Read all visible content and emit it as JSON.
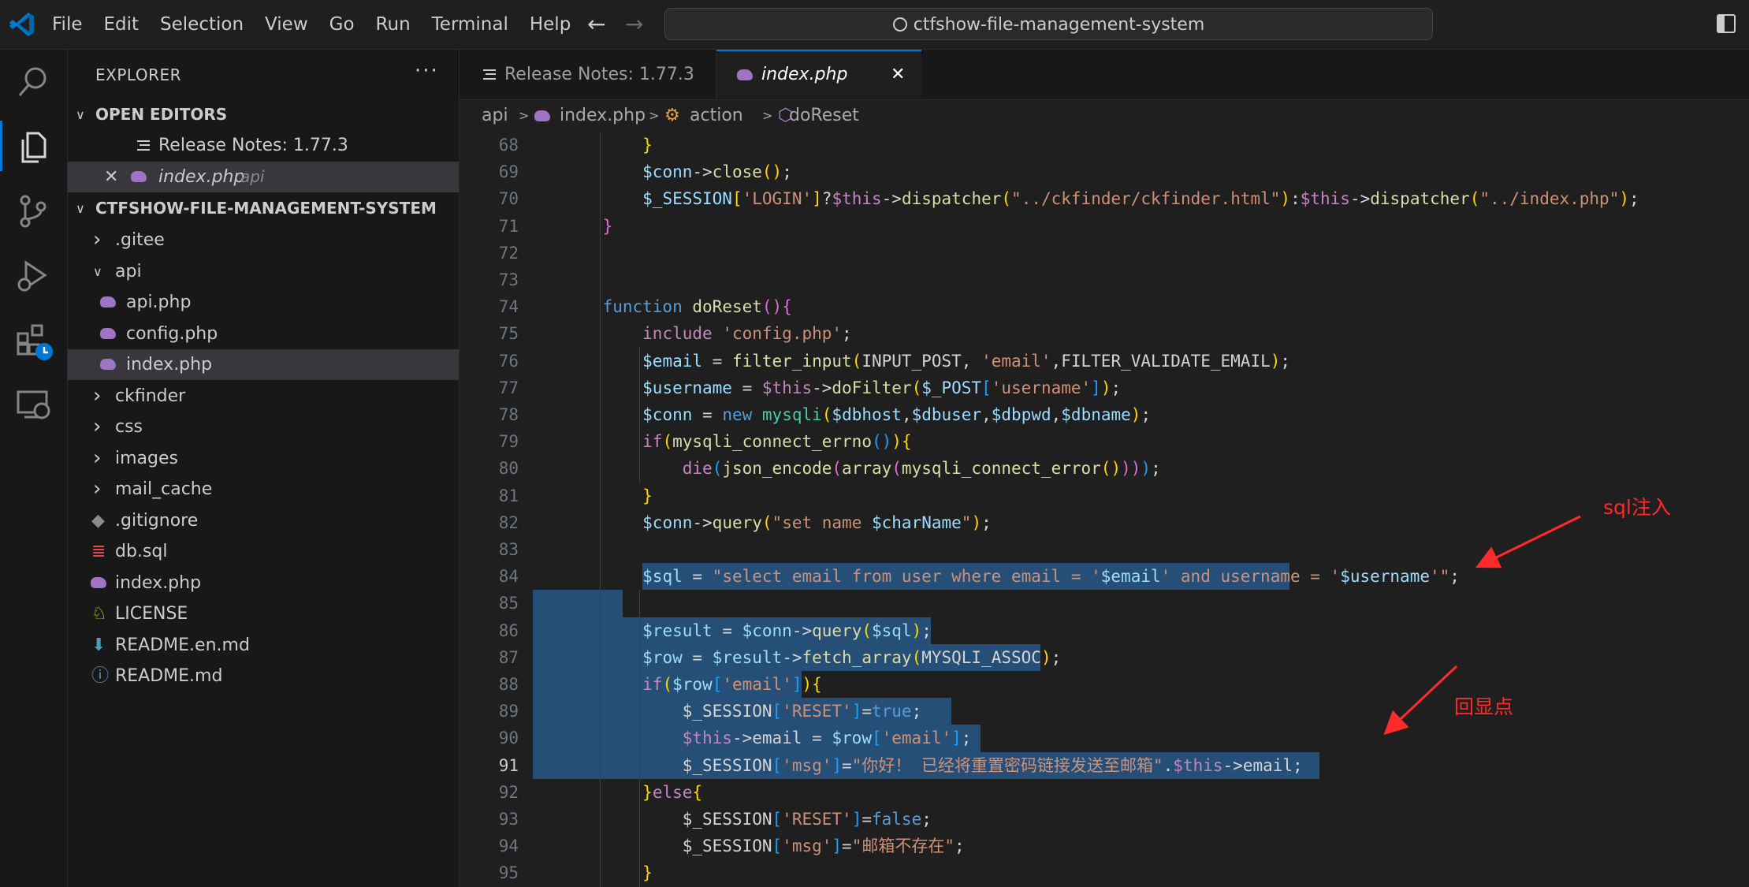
{
  "titlebar": {
    "menu": [
      "File",
      "Edit",
      "Selection",
      "View",
      "Go",
      "Run",
      "Terminal",
      "Help"
    ],
    "search_text": "ctfshow-file-management-system"
  },
  "sidebar": {
    "title": "EXPLORER",
    "more": "···",
    "open_editors_label": "OPEN EDITORS",
    "open_editors": [
      {
        "name": "Release Notes: 1.77.3",
        "hint": ""
      },
      {
        "name": "index.php",
        "hint": "api"
      }
    ],
    "project_label": "CTFSHOW-FILE-MANAGEMENT-SYSTEM",
    "tree": [
      {
        "name": ".gitee",
        "type": "folder",
        "depth": 0,
        "open": false
      },
      {
        "name": "api",
        "type": "folder",
        "depth": 0,
        "open": true
      },
      {
        "name": "api.php",
        "type": "php",
        "depth": 1
      },
      {
        "name": "config.php",
        "type": "php",
        "depth": 1
      },
      {
        "name": "index.php",
        "type": "php",
        "depth": 1,
        "selected": true
      },
      {
        "name": "ckfinder",
        "type": "folder",
        "depth": 0,
        "open": false
      },
      {
        "name": "css",
        "type": "folder",
        "depth": 0,
        "open": false
      },
      {
        "name": "images",
        "type": "folder",
        "depth": 0,
        "open": false
      },
      {
        "name": "mail_cache",
        "type": "folder",
        "depth": 0,
        "open": false
      },
      {
        "name": ".gitignore",
        "type": "git",
        "depth": 0
      },
      {
        "name": "db.sql",
        "type": "db",
        "depth": 0
      },
      {
        "name": "index.php",
        "type": "php",
        "depth": 0
      },
      {
        "name": "LICENSE",
        "type": "license",
        "depth": 0
      },
      {
        "name": "README.en.md",
        "type": "download",
        "depth": 0
      },
      {
        "name": "README.md",
        "type": "info",
        "depth": 0
      }
    ]
  },
  "tabs": [
    {
      "label": "Release Notes: 1.77.3",
      "active": false
    },
    {
      "label": "index.php",
      "active": true
    }
  ],
  "breadcrumb": [
    "api",
    "index.php",
    "action",
    "doReset"
  ],
  "colors": {
    "keyword": "#c586c0",
    "variable": "#9cdcfe",
    "string": "#ce9178",
    "function": "#dcdcaa",
    "selection": "#264f78",
    "annotation": "#ff2a2a",
    "accent": "#0078d4"
  },
  "editor": {
    "current_line": 91,
    "lines": [
      {
        "n": 68,
        "tokens": [
          [
            "        ",
            "p"
          ],
          [
            "}",
            "b1"
          ]
        ]
      },
      {
        "n": 69,
        "tokens": [
          [
            "        ",
            "p"
          ],
          [
            "$conn",
            "v"
          ],
          [
            "->",
            "p"
          ],
          [
            "close",
            "f"
          ],
          [
            "()",
            "b1"
          ],
          [
            ";",
            "p"
          ]
        ]
      },
      {
        "n": 70,
        "tokens": [
          [
            "        ",
            "p"
          ],
          [
            "$_SESSION",
            "v"
          ],
          [
            "[",
            "b1"
          ],
          [
            "'LOGIN'",
            "s"
          ],
          [
            "]",
            "b1"
          ],
          [
            "?",
            "p"
          ],
          [
            "$this",
            "k"
          ],
          [
            "->",
            "p"
          ],
          [
            "dispatcher",
            "f"
          ],
          [
            "(",
            "b1"
          ],
          [
            "\"../ckfinder/ckfinder.html\"",
            "s"
          ],
          [
            ")",
            "b1"
          ],
          [
            ":",
            "p"
          ],
          [
            "$this",
            "k"
          ],
          [
            "->",
            "p"
          ],
          [
            "dispatcher",
            "f"
          ],
          [
            "(",
            "b1"
          ],
          [
            "\"../index.php\"",
            "s"
          ],
          [
            ")",
            "b1"
          ],
          [
            ";",
            "p"
          ]
        ]
      },
      {
        "n": 71,
        "tokens": [
          [
            "    ",
            "p"
          ],
          [
            "}",
            "b2"
          ]
        ]
      },
      {
        "n": 72,
        "tokens": []
      },
      {
        "n": 73,
        "tokens": []
      },
      {
        "n": 74,
        "tokens": [
          [
            "    ",
            "p"
          ],
          [
            "function",
            "kw"
          ],
          [
            " ",
            "p"
          ],
          [
            "doReset",
            "f"
          ],
          [
            "()",
            "b2"
          ],
          [
            "{",
            "b2"
          ]
        ]
      },
      {
        "n": 75,
        "tokens": [
          [
            "        ",
            "p"
          ],
          [
            "include",
            "k"
          ],
          [
            " ",
            "p"
          ],
          [
            "'config.php'",
            "s"
          ],
          [
            ";",
            "p"
          ]
        ]
      },
      {
        "n": 76,
        "tokens": [
          [
            "        ",
            "p"
          ],
          [
            "$email",
            "v"
          ],
          [
            " = ",
            "p"
          ],
          [
            "filter_input",
            "f"
          ],
          [
            "(",
            "b1"
          ],
          [
            "INPUT_POST",
            "p"
          ],
          [
            ", ",
            "p"
          ],
          [
            "'email'",
            "s"
          ],
          [
            ",",
            "p"
          ],
          [
            "FILTER_VALIDATE_EMAIL",
            "p"
          ],
          [
            ")",
            "b1"
          ],
          [
            ";",
            "p"
          ]
        ]
      },
      {
        "n": 77,
        "tokens": [
          [
            "        ",
            "p"
          ],
          [
            "$username",
            "v"
          ],
          [
            " = ",
            "p"
          ],
          [
            "$this",
            "k"
          ],
          [
            "->",
            "p"
          ],
          [
            "doFilter",
            "f"
          ],
          [
            "(",
            "b1"
          ],
          [
            "$_POST",
            "v"
          ],
          [
            "[",
            "b3"
          ],
          [
            "'username'",
            "s"
          ],
          [
            "]",
            "b3"
          ],
          [
            ")",
            "b1"
          ],
          [
            ";",
            "p"
          ]
        ]
      },
      {
        "n": 78,
        "tokens": [
          [
            "        ",
            "p"
          ],
          [
            "$conn",
            "v"
          ],
          [
            " = ",
            "p"
          ],
          [
            "new",
            "kw"
          ],
          [
            " ",
            "p"
          ],
          [
            "mysqli",
            "t"
          ],
          [
            "(",
            "b1"
          ],
          [
            "$dbhost",
            "v"
          ],
          [
            ",",
            "p"
          ],
          [
            "$dbuser",
            "v"
          ],
          [
            ",",
            "p"
          ],
          [
            "$dbpwd",
            "v"
          ],
          [
            ",",
            "p"
          ],
          [
            "$dbname",
            "v"
          ],
          [
            ")",
            "b1"
          ],
          [
            ";",
            "p"
          ]
        ]
      },
      {
        "n": 79,
        "tokens": [
          [
            "        ",
            "p"
          ],
          [
            "if",
            "k"
          ],
          [
            "(",
            "b1"
          ],
          [
            "mysqli_connect_errno",
            "f"
          ],
          [
            "()",
            "b3"
          ],
          [
            ")",
            "b1"
          ],
          [
            "{",
            "b1"
          ]
        ]
      },
      {
        "n": 80,
        "tokens": [
          [
            "            ",
            "p"
          ],
          [
            "die",
            "k"
          ],
          [
            "(",
            "b3"
          ],
          [
            "json_encode",
            "f"
          ],
          [
            "(",
            "b2"
          ],
          [
            "array",
            "f"
          ],
          [
            "(",
            "b4"
          ],
          [
            "mysqli_connect_error",
            "f"
          ],
          [
            "()",
            "b1"
          ],
          [
            ")",
            "b4"
          ],
          [
            ")",
            "b2"
          ],
          [
            ")",
            "b3"
          ],
          [
            ";",
            "p"
          ]
        ]
      },
      {
        "n": 81,
        "tokens": [
          [
            "        ",
            "p"
          ],
          [
            "}",
            "b1"
          ]
        ]
      },
      {
        "n": 82,
        "tokens": [
          [
            "        ",
            "p"
          ],
          [
            "$conn",
            "v"
          ],
          [
            "->",
            "p"
          ],
          [
            "query",
            "f"
          ],
          [
            "(",
            "b1"
          ],
          [
            "\"set name ",
            "s"
          ],
          [
            "$charName",
            "v"
          ],
          [
            "\"",
            "s"
          ],
          [
            ")",
            "b1"
          ],
          [
            ";",
            "p"
          ]
        ]
      },
      {
        "n": 83,
        "tokens": []
      },
      {
        "n": 84,
        "tokens": [
          [
            "        ",
            "p"
          ],
          [
            "$sql",
            "v"
          ],
          [
            " = ",
            "p"
          ],
          [
            "\"select email from user where email = '",
            "s"
          ],
          [
            "$email",
            "v"
          ],
          [
            "' and username = '",
            "s"
          ],
          [
            "$username",
            "v"
          ],
          [
            "'\"",
            "s"
          ],
          [
            ";",
            "p"
          ]
        ]
      },
      {
        "n": 85,
        "tokens": []
      },
      {
        "n": 86,
        "tokens": [
          [
            "        ",
            "p"
          ],
          [
            "$result",
            "v"
          ],
          [
            " = ",
            "p"
          ],
          [
            "$conn",
            "v"
          ],
          [
            "->",
            "p"
          ],
          [
            "query",
            "f"
          ],
          [
            "(",
            "b1"
          ],
          [
            "$sql",
            "v"
          ],
          [
            ")",
            "b1"
          ],
          [
            ";",
            "p"
          ]
        ]
      },
      {
        "n": 87,
        "tokens": [
          [
            "        ",
            "p"
          ],
          [
            "$row",
            "v"
          ],
          [
            " = ",
            "p"
          ],
          [
            "$result",
            "v"
          ],
          [
            "->",
            "p"
          ],
          [
            "fetch_array",
            "f"
          ],
          [
            "(",
            "b1"
          ],
          [
            "MYSQLI_ASSOC",
            "p"
          ],
          [
            ")",
            "b1"
          ],
          [
            ";",
            "p"
          ]
        ]
      },
      {
        "n": 88,
        "tokens": [
          [
            "        ",
            "p"
          ],
          [
            "if",
            "k"
          ],
          [
            "(",
            "b1"
          ],
          [
            "$row",
            "v"
          ],
          [
            "[",
            "b3"
          ],
          [
            "'email'",
            "s"
          ],
          [
            "]",
            "b3"
          ],
          [
            ")",
            "b1"
          ],
          [
            "{",
            "b1"
          ]
        ]
      },
      {
        "n": 89,
        "tokens": [
          [
            "            ",
            "p"
          ],
          [
            "$_SESSION",
            "p"
          ],
          [
            "[",
            "b3"
          ],
          [
            "'RESET'",
            "s"
          ],
          [
            "]",
            "b3"
          ],
          [
            "=",
            "p"
          ],
          [
            "true",
            "kb"
          ],
          [
            ";",
            "p"
          ]
        ]
      },
      {
        "n": 90,
        "tokens": [
          [
            "            ",
            "p"
          ],
          [
            "$this",
            "k"
          ],
          [
            "->",
            "p"
          ],
          [
            "email",
            "p"
          ],
          [
            " = ",
            "p"
          ],
          [
            "$row",
            "v"
          ],
          [
            "[",
            "b3"
          ],
          [
            "'email'",
            "s"
          ],
          [
            "]",
            "b3"
          ],
          [
            ";",
            "p"
          ]
        ]
      },
      {
        "n": 91,
        "tokens": [
          [
            "            ",
            "p"
          ],
          [
            "$_SESSION",
            "p"
          ],
          [
            "[",
            "b3"
          ],
          [
            "'msg'",
            "s"
          ],
          [
            "]",
            "b3"
          ],
          [
            "=",
            "p"
          ],
          [
            "\"你好！ 已经将重置密码链接发送至邮箱\"",
            "s"
          ],
          [
            ".",
            "p"
          ],
          [
            "$this",
            "k"
          ],
          [
            "->",
            "p"
          ],
          [
            "email",
            "p"
          ],
          [
            ";",
            "p"
          ]
        ]
      },
      {
        "n": 92,
        "tokens": [
          [
            "        ",
            "p"
          ],
          [
            "}",
            "b1"
          ],
          [
            "else",
            "k"
          ],
          [
            "{",
            "b1"
          ]
        ]
      },
      {
        "n": 93,
        "tokens": [
          [
            "            ",
            "p"
          ],
          [
            "$_SESSION",
            "p"
          ],
          [
            "[",
            "b3"
          ],
          [
            "'RESET'",
            "s"
          ],
          [
            "]",
            "b3"
          ],
          [
            "=",
            "p"
          ],
          [
            "false",
            "kb"
          ],
          [
            ";",
            "p"
          ]
        ]
      },
      {
        "n": 94,
        "tokens": [
          [
            "            ",
            "p"
          ],
          [
            "$_SESSION",
            "p"
          ],
          [
            "[",
            "b3"
          ],
          [
            "'msg'",
            "s"
          ],
          [
            "]",
            "b3"
          ],
          [
            "=",
            "p"
          ],
          [
            "\"邮箱不存在\"",
            "s"
          ],
          [
            ";",
            "p"
          ]
        ]
      },
      {
        "n": 95,
        "tokens": [
          [
            "        ",
            "p"
          ],
          [
            "}",
            "b1"
          ]
        ]
      }
    ]
  },
  "annotations": [
    {
      "text": "sql注入"
    },
    {
      "text": "回显点"
    }
  ]
}
